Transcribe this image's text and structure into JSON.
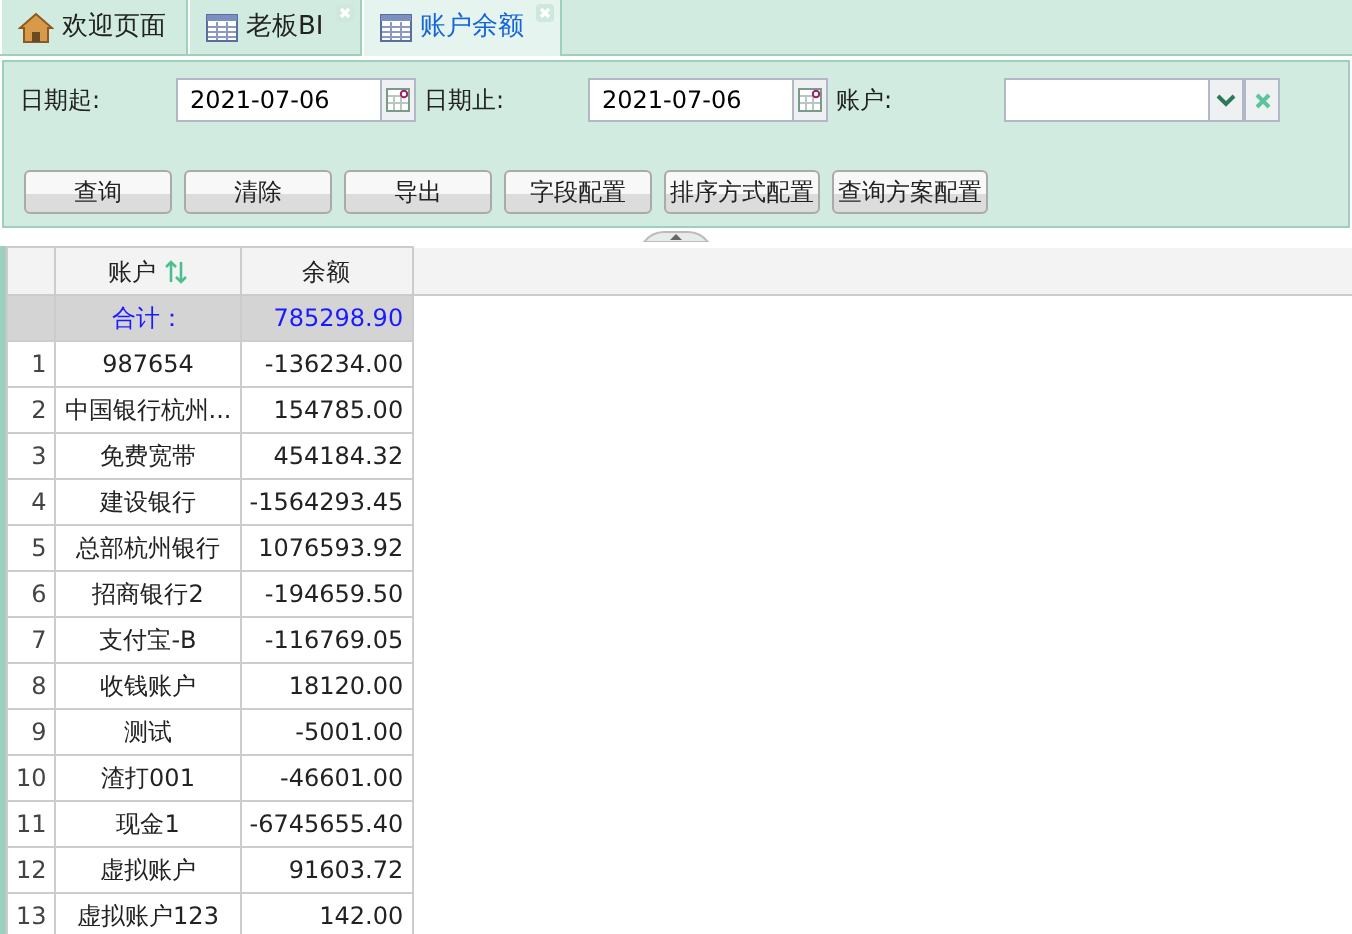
{
  "tabs": [
    {
      "label": "欢迎页面",
      "closable": false,
      "selected": false
    },
    {
      "label": "老板BI",
      "closable": true,
      "selected": false
    },
    {
      "label": "账户余额",
      "closable": true,
      "selected": true
    }
  ],
  "filters": [
    {
      "kind": "date",
      "label": "日期起:",
      "value": "2021-07-06"
    },
    {
      "kind": "date",
      "label": "日期止:",
      "value": "2021-07-06"
    },
    {
      "kind": "select",
      "label": "账户:"
    }
  ],
  "buttons": [
    "查询",
    "清除",
    "导出",
    "字段配置",
    "排序方式配置",
    "查询方案配置"
  ],
  "table": {
    "columns": [
      {
        "label": "账户",
        "sortable": true
      },
      {
        "label": "余额",
        "sortable": false
      }
    ],
    "total": {
      "label": "合计：",
      "value": "785298.90"
    },
    "rows": [
      {
        "index": "1",
        "account": "987654",
        "balance": "-136234.00"
      },
      {
        "index": "2",
        "account": "中国银行杭州...",
        "balance": "154785.00"
      },
      {
        "index": "3",
        "account": "免费宽带",
        "balance": "454184.32"
      },
      {
        "index": "4",
        "account": "建设银行",
        "balance": "-1564293.45"
      },
      {
        "index": "5",
        "account": "总部杭州银行",
        "balance": "1076593.92"
      },
      {
        "index": "6",
        "account": "招商银行2",
        "balance": "-194659.50"
      },
      {
        "index": "7",
        "account": "支付宝-B",
        "balance": "-116769.05"
      },
      {
        "index": "8",
        "account": "收钱账户",
        "balance": "18120.00"
      },
      {
        "index": "9",
        "account": "测试",
        "balance": "-5001.00"
      },
      {
        "index": "10",
        "account": "渣打001",
        "balance": "-46601.00"
      },
      {
        "index": "11",
        "account": "现金1",
        "balance": "-6745655.40"
      },
      {
        "index": "12",
        "account": "虚拟账户",
        "balance": "91603.72"
      },
      {
        "index": "13",
        "account": "虚拟账户123",
        "balance": "142.00"
      }
    ]
  }
}
